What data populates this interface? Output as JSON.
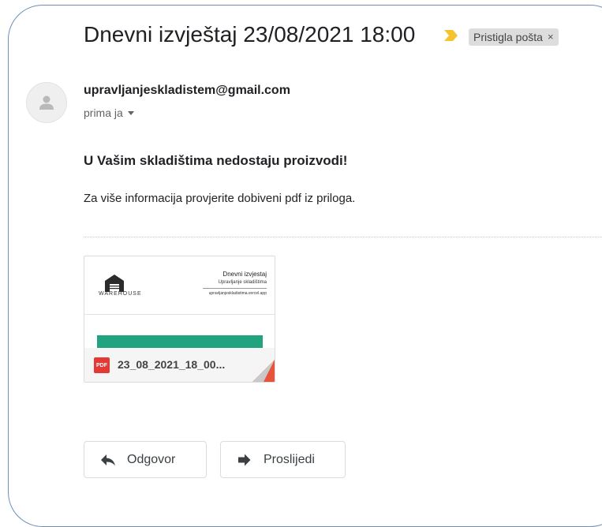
{
  "email": {
    "subject": "Dnevni izvještaj 23/08/2021 18:00",
    "label": "Pristigla pošta",
    "label_close": "×",
    "sender": "upravljanjeskladistem@gmail.com",
    "recipient": "prima ja",
    "headline": "U Vašim skladištima nedostaju proizvodi!",
    "body": "Za više informacija provjerite dobiveni pdf iz priloga."
  },
  "attachment": {
    "type_badge": "PDF",
    "filename": "23_08_2021_18_00...",
    "preview": {
      "logo_text": "WAREHOUSE",
      "title": "Dnevni izvjestaj",
      "subtitle": "Upravljanje skladištima",
      "url": "upravljanjeskladistima.vercel.app"
    }
  },
  "actions": {
    "reply_label": "Odgovor",
    "forward_label": "Proslijedi"
  },
  "icons": {
    "importance": "importance-marker-icon",
    "avatar": "person-icon",
    "reply": "reply-arrow-icon",
    "forward": "forward-arrow-icon"
  },
  "colors": {
    "importance": "#f4c430",
    "pdf_badge": "#e53935",
    "table_header": "#22a37f",
    "frame_border": "#6d8fb8"
  }
}
